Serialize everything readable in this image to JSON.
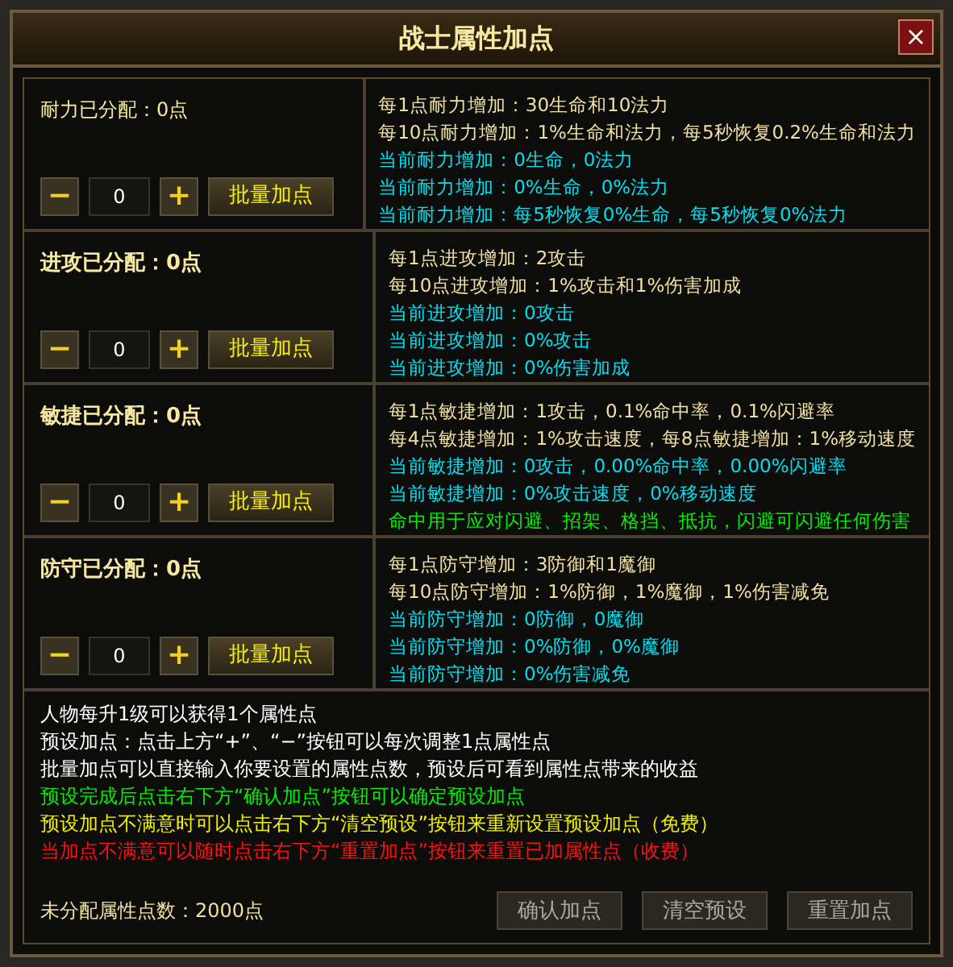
{
  "window": {
    "title": "战士属性加点",
    "close": "×"
  },
  "attributes": [
    {
      "label": "耐力已分配：0点",
      "emphasized": false,
      "value": "0",
      "minus": "−",
      "plus": "+",
      "batch_button": "批量加点",
      "lines": [
        {
          "text": "每1点耐力增加：30生命和10法力",
          "color": "#f0e0a0"
        },
        {
          "text": "每10点耐力增加：1%生命和法力，每5秒恢复0.2%生命和法力",
          "color": "#f0e0a0"
        },
        {
          "text": "当前耐力增加：0生命，0法力",
          "color": "#00e0f0"
        },
        {
          "text": "当前耐力增加：0%生命，0%法力",
          "color": "#00e0f0"
        },
        {
          "text": "当前耐力增加：每5秒恢复0%生命，每5秒恢复0%法力",
          "color": "#00e0f0"
        }
      ]
    },
    {
      "label": "进攻已分配：0点",
      "emphasized": true,
      "value": "0",
      "minus": "−",
      "plus": "+",
      "batch_button": "批量加点",
      "lines": [
        {
          "text": "每1点进攻增加：2攻击",
          "color": "#f0e0a0"
        },
        {
          "text": "每10点进攻增加：1%攻击和1%伤害加成",
          "color": "#f0e0a0"
        },
        {
          "text": "当前进攻增加：0攻击",
          "color": "#00e0f0"
        },
        {
          "text": "当前进攻增加：0%攻击",
          "color": "#00e0f0"
        },
        {
          "text": "当前进攻增加：0%伤害加成",
          "color": "#00e0f0"
        }
      ]
    },
    {
      "label": "敏捷已分配：0点",
      "emphasized": true,
      "value": "0",
      "minus": "−",
      "plus": "+",
      "batch_button": "批量加点",
      "lines": [
        {
          "text": "每1点敏捷增加：1攻击，0.1%命中率，0.1%闪避率",
          "color": "#f0e0a0"
        },
        {
          "text": "每4点敏捷增加：1%攻击速度，每8点敏捷增加：1%移动速度",
          "color": "#f0e0a0"
        },
        {
          "text": "当前敏捷增加：0攻击，0.00%命中率，0.00%闪避率",
          "color": "#00e0f0"
        },
        {
          "text": "当前敏捷增加：0%攻击速度，0%移动速度",
          "color": "#00e0f0"
        },
        {
          "text": "命中用于应对闪避、招架、格挡、抵抗，闪避可闪避任何伤害",
          "color": "#00f000"
        }
      ]
    },
    {
      "label": "防守已分配：0点",
      "emphasized": true,
      "value": "0",
      "minus": "−",
      "plus": "+",
      "batch_button": "批量加点",
      "lines": [
        {
          "text": "每1点防守增加：3防御和1魔御",
          "color": "#f0e0a0"
        },
        {
          "text": "每10点防守增加：1%防御，1%魔御，1%伤害减免",
          "color": "#f0e0a0"
        },
        {
          "text": "当前防守增加：0防御，0魔御",
          "color": "#00e0f0"
        },
        {
          "text": "当前防守增加：0%防御，0%魔御",
          "color": "#00e0f0"
        },
        {
          "text": "当前防守增加：0%伤害减免",
          "color": "#00e0f0"
        }
      ]
    }
  ],
  "notes": [
    {
      "text": "人物每升1级可以获得1个属性点",
      "color": "#ffffff"
    },
    {
      "text": "预设加点：点击上方“+”、“−”按钮可以每次调整1点属性点",
      "color": "#ffffff"
    },
    {
      "text": "批量加点可以直接输入你要设置的属性点数，预设后可看到属性点带来的收益",
      "color": "#ffffff"
    },
    {
      "text": "预设完成后点击右下方“确认加点”按钮可以确定预设加点",
      "color": "#00f000"
    },
    {
      "text": "预设加点不满意时可以点击右下方“清空预设”按钮来重新设置预设加点（免费）",
      "color": "#f0f000"
    },
    {
      "text": "当加点不满意可以随时点击右下方“重置加点”按钮来重置已加属性点（收费）",
      "color": "#ff1010"
    }
  ],
  "unallocated": "未分配属性点数：2000点",
  "buttons": [
    {
      "label": "确认加点",
      "disabled": true
    },
    {
      "label": "清空预设",
      "disabled": true
    },
    {
      "label": "重置加点",
      "disabled": true
    }
  ]
}
